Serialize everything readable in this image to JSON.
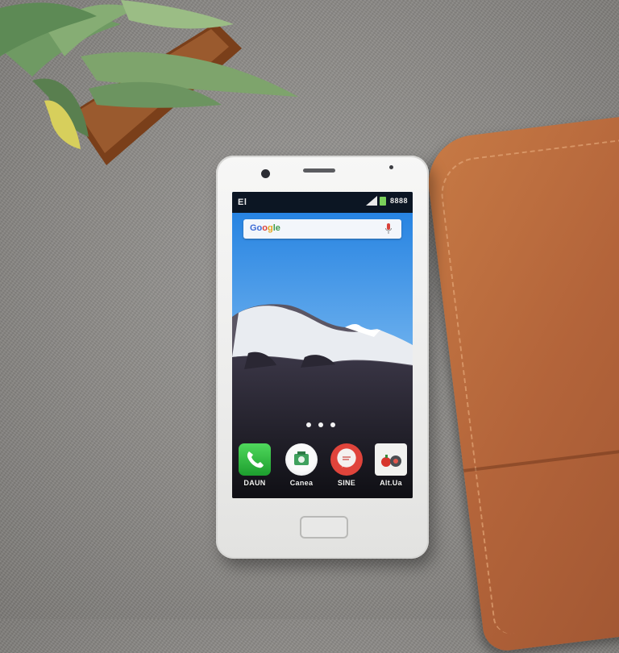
{
  "status_bar": {
    "carrier": "El",
    "clock": "8888"
  },
  "search_widget": {
    "logo_parts": [
      "Go",
      "o",
      "g",
      "le"
    ]
  },
  "home_screen": {
    "page_count": 3,
    "dock_apps": [
      {
        "label": "DAUN",
        "icon": "phone-icon"
      },
      {
        "label": "Canea",
        "icon": "camera-icon"
      },
      {
        "label": "SINE",
        "icon": "messages-icon"
      },
      {
        "label": "Alt.Ua",
        "icon": "media-icon"
      }
    ]
  },
  "colors": {
    "leather": "#b3643a",
    "fabric": "#8b8986",
    "phone_body": "#f2f2f1",
    "sky_top": "#1d7de0",
    "sky_bottom": "#cfe3f5"
  }
}
